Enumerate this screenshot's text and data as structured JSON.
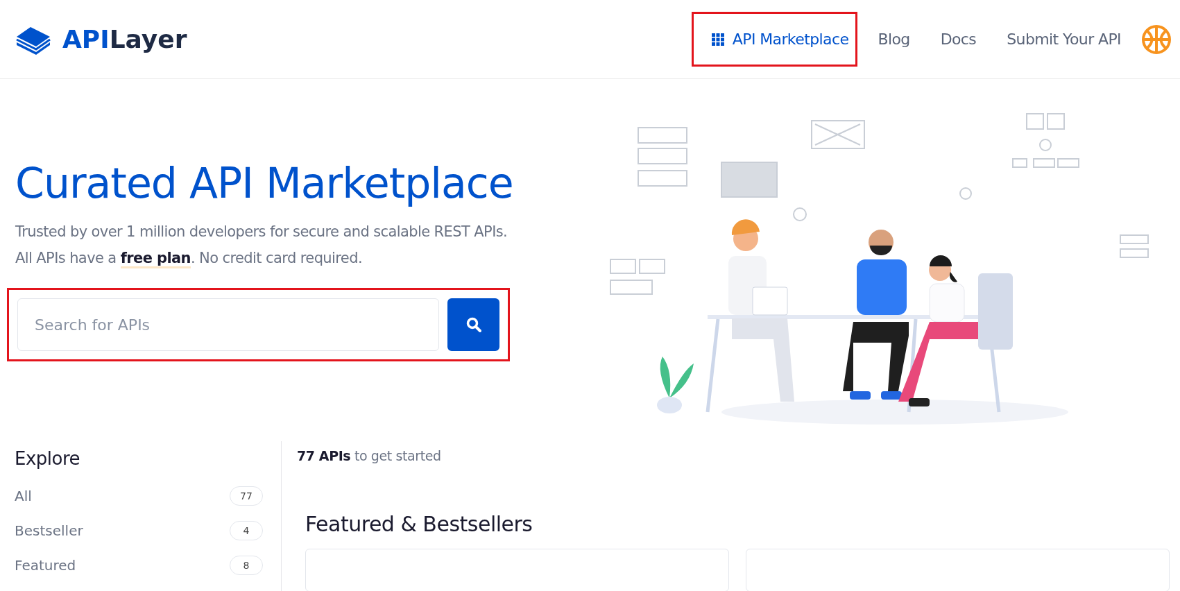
{
  "header": {
    "logo": {
      "part_1": "API",
      "part_2": "Layer"
    },
    "nav": [
      {
        "label": "API Marketplace",
        "selected": true,
        "highlighted": true,
        "kind": "grid"
      },
      {
        "label": "Blog",
        "selected": false,
        "highlighted": false,
        "kind": "text"
      },
      {
        "label": "Docs",
        "selected": false,
        "highlighted": false,
        "kind": "text"
      },
      {
        "label": "Submit Your API",
        "selected": false,
        "highlighted": false,
        "kind": "text"
      }
    ]
  },
  "hero": {
    "title": "Curated API Marketplace",
    "subtitle_lines": [
      "Trusted by over 1 million developers for secure and scalable REST APIs.",
      "All APIs have a **free plan**. No credit card required."
    ],
    "search": {
      "placeholder": "Search for APIs",
      "highlighted": true
    }
  },
  "sidebar": {
    "title": "Explore",
    "items": [
      {
        "label": "All",
        "count": "77"
      },
      {
        "label": "Bestseller",
        "count": "4"
      },
      {
        "label": "Featured",
        "count": "8"
      }
    ]
  },
  "main": {
    "summary": "**77 APIs** to get started",
    "section_title": "Featured & Bestsellers"
  }
}
